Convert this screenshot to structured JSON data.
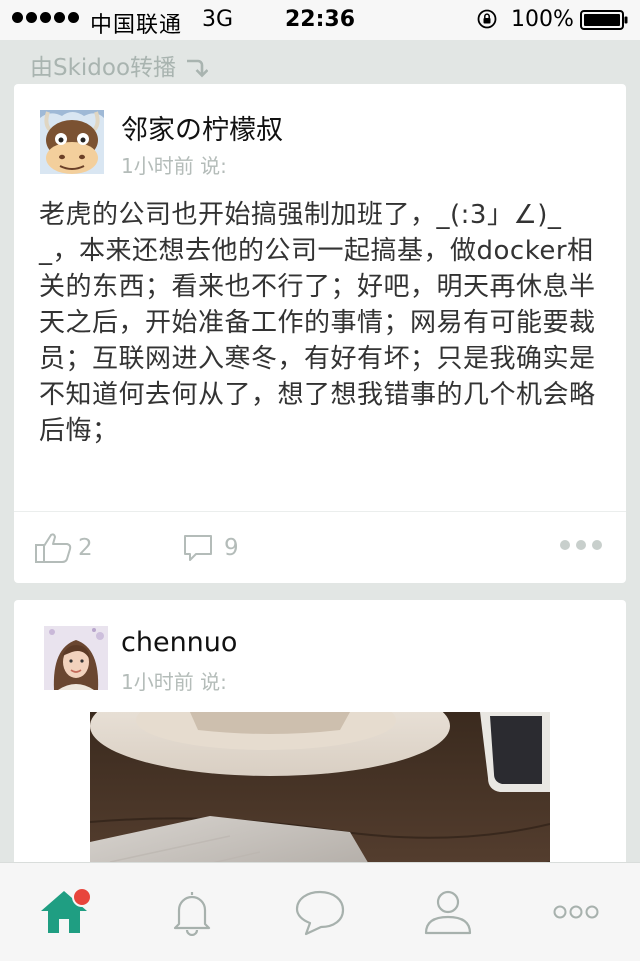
{
  "status_bar": {
    "carrier": "中国联通",
    "network": "3G",
    "time": "22:36",
    "battery": "100%"
  },
  "forward": {
    "label": "由Skidoo转播"
  },
  "posts": [
    {
      "author": "邻家の柠檬叔",
      "meta": "1小时前 说:",
      "text": "老虎的公司也开始搞强制加班了，_(:3」∠)__，本来还想去他的公司一起搞基，做docker相关的东西；看来也不行了；好吧，明天再休息半天之后，开始准备工作的事情；网易有可能要裁员；互联网进入寒冬，有好有坏；只是我确实是不知道何去何从了，想了想我错事的几个机会略后悔；",
      "likes": "2",
      "comments": "9"
    },
    {
      "author": "chennuo",
      "meta": "1小时前 说:"
    }
  ],
  "tab_bar": {
    "tabs": [
      {
        "icon": "home-icon",
        "active": true,
        "badge": true
      },
      {
        "icon": "bell-icon"
      },
      {
        "icon": "chat-bubble-icon"
      },
      {
        "icon": "person-icon"
      },
      {
        "icon": "more-dots-icon"
      }
    ]
  },
  "colors": {
    "accent": "#1f9e82",
    "badge": "#e8453c",
    "muted": "#b4bcb9",
    "background": "#e2e6e4"
  }
}
